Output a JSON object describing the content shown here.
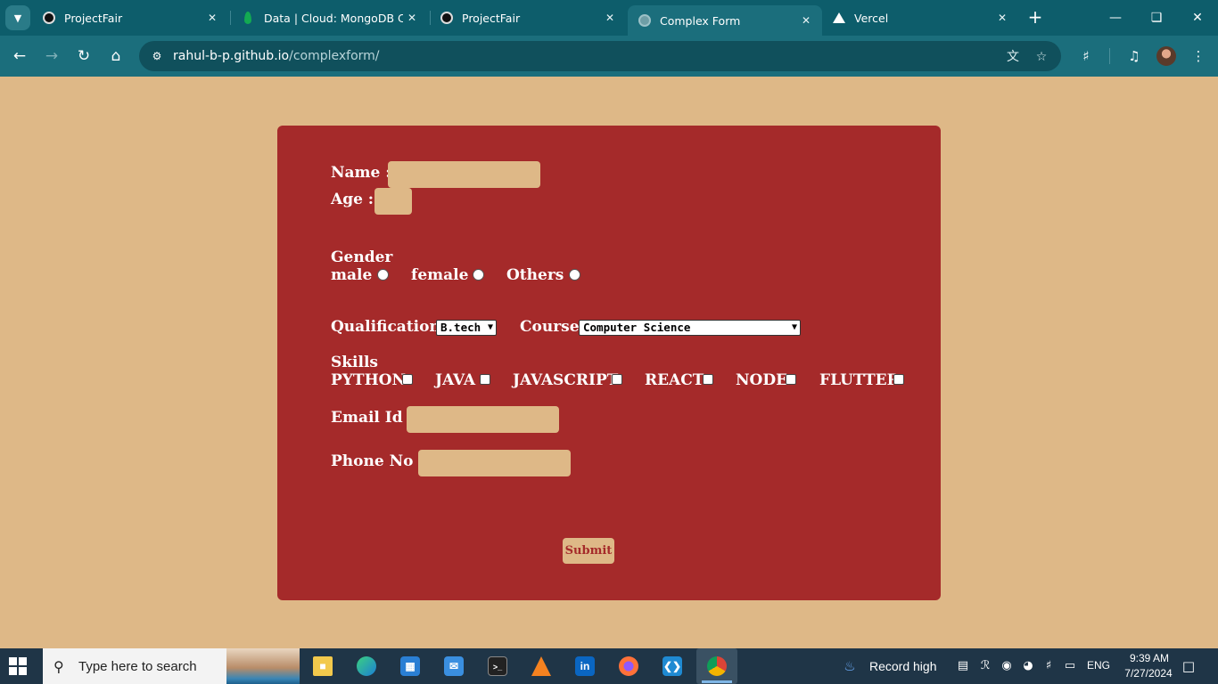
{
  "browser": {
    "tabs": [
      {
        "title": "ProjectFair",
        "favicon": "github-favicon",
        "active": false
      },
      {
        "title": "Data | Cloud: MongoDB Cloud",
        "favicon": "mongodb-favicon",
        "active": false
      },
      {
        "title": "ProjectFair",
        "favicon": "github-favicon",
        "active": false
      },
      {
        "title": "Complex Form",
        "favicon": "globe-favicon",
        "active": true
      },
      {
        "title": "Vercel",
        "favicon": "vercel-favicon",
        "active": false
      }
    ],
    "url_host": "rahul-b-p.github.io",
    "url_path": "/complexform/",
    "colors": {
      "tabbar": "#0d5d6b",
      "toolbar": "#1b6e7c"
    }
  },
  "form": {
    "name_label": "Name :",
    "name_value": "",
    "age_label": "Age :",
    "age_value": "",
    "gender_label": "Gender",
    "gender_options": [
      "male",
      "female",
      "Others"
    ],
    "qualification_label": "Qualification",
    "qualification_value": "B.tech",
    "course_label": "Course",
    "course_value": "Computer Science",
    "skills_label": "Skills",
    "skills": [
      "PYTHON",
      "JAVA",
      "JAVASCRIPT",
      "REACT",
      "NODE",
      "FLUTTER"
    ],
    "email_label": "Email Id :",
    "email_value": "",
    "phone_label": "Phone No :",
    "phone_value": "",
    "submit_label": "Submit",
    "colors": {
      "page_bg": "#deb887",
      "card_bg": "#a52a2a",
      "input_bg": "#deb887",
      "text": "#ffffff"
    }
  },
  "taskbar": {
    "search_placeholder": "Type here to search",
    "apps": [
      "file-explorer",
      "edge",
      "microsoft-store",
      "mail",
      "terminal",
      "vlc",
      "linkedin",
      "firefox",
      "vscode",
      "chrome"
    ],
    "weather_text": "Record high",
    "language": "ENG",
    "time": "9:39 AM",
    "date": "7/27/2024"
  }
}
